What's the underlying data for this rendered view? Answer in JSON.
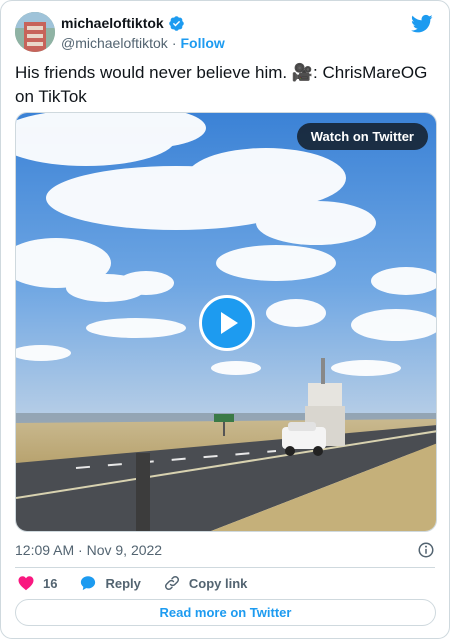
{
  "user": {
    "display_name": "michaeloftiktok",
    "handle": "@michaeloftiktok",
    "separator": "·",
    "follow_label": "Follow",
    "verified": true
  },
  "tweet": {
    "text": "His friends would never believe him. 🎥: ChrisMareOG on TikTok"
  },
  "media": {
    "watch_label": "Watch on Twitter",
    "type": "video"
  },
  "meta": {
    "timestamp": "12:09 AM · Nov 9, 2022"
  },
  "actions": {
    "likes_count": "16",
    "reply_label": "Reply",
    "copy_label": "Copy link"
  },
  "footer": {
    "read_more_label": "Read more on Twitter"
  },
  "colors": {
    "accent": "#1d9bf0",
    "like": "#f91880",
    "muted": "#536471"
  }
}
